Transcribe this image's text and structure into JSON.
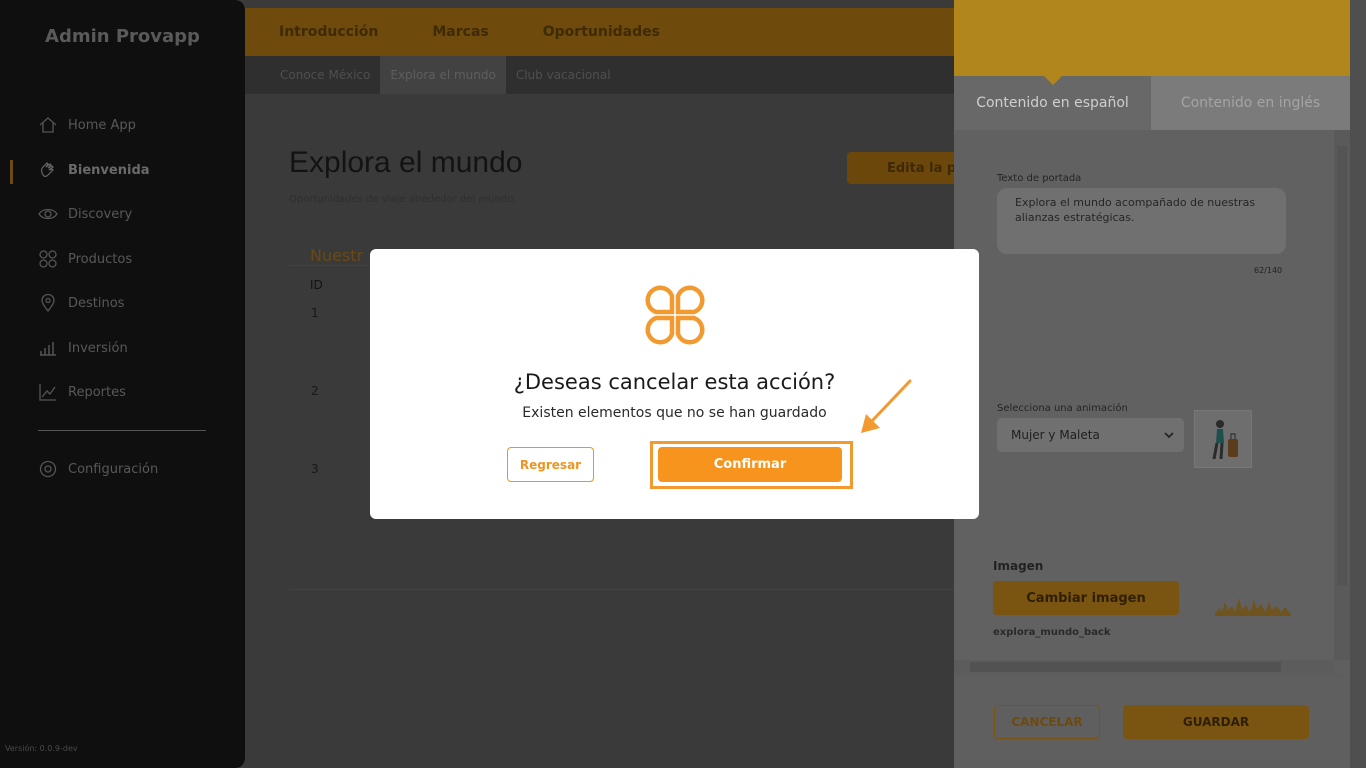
{
  "sidebar": {
    "brand": "Admin Provapp",
    "items": [
      {
        "label": "Home App",
        "icon": "home-icon"
      },
      {
        "label": "Bienvenida",
        "icon": "hand-wave-icon"
      },
      {
        "label": "Discovery",
        "icon": "eye-icon"
      },
      {
        "label": "Productos",
        "icon": "grid-icon"
      },
      {
        "label": "Destinos",
        "icon": "map-pin-icon"
      },
      {
        "label": "Inversión",
        "icon": "bar-chart-icon"
      },
      {
        "label": "Reportes",
        "icon": "line-chart-icon"
      }
    ],
    "settings": {
      "label": "Configuración",
      "icon": "gear-icon"
    },
    "version": "Versión: 0.0.9-dev"
  },
  "topnav": {
    "tabs": [
      "Introducción",
      "Marcas",
      "Oportunidades"
    ]
  },
  "subnav": {
    "tabs": [
      "Conoce México",
      "Explora el mundo",
      "Club vacacional"
    ],
    "active": "Explora el mundo"
  },
  "main": {
    "title": "Explora el mundo",
    "subtitle": "Oportunidades de viaje alrededor del mundo.",
    "edit_button": "Edita la po",
    "section_heading": "Nuestr",
    "col_id": "ID",
    "rows": [
      "1",
      "2",
      "3"
    ]
  },
  "panel": {
    "tabs": [
      "Contenido en español",
      "Contenido en inglés"
    ],
    "cover_text_label": "Texto de portada",
    "cover_text_value": "Explora el mundo acompañado de nuestras alianzas estratégicas.",
    "counter": "62/140",
    "animation_label": "Selecciona una animación",
    "animation_value": "Mujer y Maleta",
    "image_label": "Imagen",
    "change_image_button": "Cambiar imagen",
    "file_name": "explora_mundo_back",
    "cancel_button": "CANCELAR",
    "save_button": "GUARDAR"
  },
  "modal": {
    "title": "¿Deseas cancelar esta acción?",
    "message": "Existen elementos que no se han guardado",
    "back_button": "Regresar",
    "confirm_button": "Confirmar"
  },
  "colors": {
    "accent": "#f7941d",
    "panel_header": "#b0861d"
  }
}
